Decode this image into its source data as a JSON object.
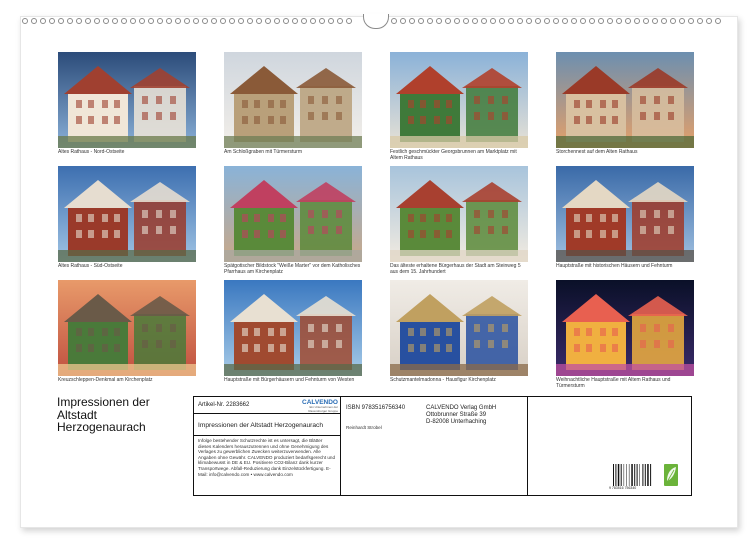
{
  "photos": [
    {
      "caption": "Altes Rathaus - Nord-Ostseite",
      "colors": [
        "#2c4c7a",
        "#8ab0d8",
        "#a04030",
        "#f0e6d8",
        "#6a7a4a"
      ]
    },
    {
      "caption": "Am Schloßgraben mit Türmersturm",
      "colors": [
        "#cfd6de",
        "#f3efe9",
        "#8a5a38",
        "#b9a07a",
        "#6f7d55"
      ]
    },
    {
      "caption": "Festlich geschmückter Georgsbrunnen am Marktplatz mit Altem Rathaus",
      "colors": [
        "#8bb2d8",
        "#e8e2d6",
        "#b0402c",
        "#3f7a3a",
        "#d8c9a6"
      ]
    },
    {
      "caption": "Storchennest auf dem Alten Rathaus",
      "colors": [
        "#6c8fb0",
        "#e6a068",
        "#9a3a28",
        "#d8c0a0",
        "#4f6a3a"
      ]
    },
    {
      "caption": "Altes Rathaus - Süd-Ostseite",
      "colors": [
        "#3d6fb0",
        "#a0c4e4",
        "#e6ddd0",
        "#9a3a2a",
        "#5a6a48"
      ]
    },
    {
      "caption": "Spätgotischer Bildstock \"Weiße Marter\" vor dem Katholisches Pfarrhaus am Kirchenplatz",
      "colors": [
        "#8ab3d8",
        "#c9a888",
        "#c04060",
        "#5a8a3a",
        "#a8a8a0"
      ]
    },
    {
      "caption": "Das älteste erhaltene Bürgerhaus der Stadt am Steinweg 5 aus dem 15. Jahrhundert",
      "colors": [
        "#a8c4dc",
        "#f2ebe0",
        "#a84030",
        "#5a8a3a",
        "#e0d6c6"
      ]
    },
    {
      "caption": "Hauptstraße mit historischen Häusern und Fehnturm",
      "colors": [
        "#3a6aa8",
        "#a0c0e0",
        "#e4d8c4",
        "#a03a28",
        "#5a5248"
      ]
    },
    {
      "caption": "Kreuzschleppen-Denkmal am Kirchenplatz",
      "colors": [
        "#e89a6a",
        "#c05040",
        "#6a5a48",
        "#4a7a3a",
        "#f0c890"
      ]
    },
    {
      "caption": "Hauptstraße mit Bürgerhäusern und Fehnturm von Westen",
      "colors": [
        "#3a78c0",
        "#a8cce8",
        "#e8e0d2",
        "#a04a30",
        "#5a6a4a"
      ]
    },
    {
      "caption": "Schutzmantelmadonna - Hausfigur Kirchenplatz",
      "colors": [
        "#f0ece6",
        "#d8d0c6",
        "#c0a060",
        "#2850a0",
        "#8a6a48"
      ]
    },
    {
      "caption": "Weihnachtliche Hauptstraße mit Altem Rathaus und Türmersturm",
      "colors": [
        "#0a1028",
        "#3a2a6a",
        "#e86050",
        "#f0b040",
        "#c050a0"
      ]
    }
  ],
  "cover_title": "Impressionen der Altstadt Herzogenaurach",
  "info": {
    "article_no": "Artikel-Nr. 2283662",
    "logo": "CALVENDO",
    "logo_sub": "Ein Unternehmen der Ravensburger Gruppe",
    "product_title": "Impressionen der Altstadt Herzogenaurach",
    "legal": "Infolge bestehender Schutzrechte ist es untersagt, die Blätter dieses Kalenders herauszutrennen und ohne Genehmigung des Verlages zu gewerblichen Zwecken weiterzuverwenden. Alle Angaben ohne Gewähr. CALVENDO produziert bedarfsgerecht und klimabewusst in DE & EU. Positivere CO2-Bilanz dank kurzer Transportwege. Abfall-Reduzierung dank Einzelstückfertigung. E-Mail: info@calvendo.com • www.calvendo.com",
    "isbn": "ISBN 9783516756340",
    "author": "Reinhardt Strobel",
    "publisher": "CALVENDO Verlag GmbH",
    "street": "Ottobrunner Straße 39",
    "city": "D-82008 Unterhaching",
    "barcode_digits": "9 783516 756340"
  }
}
